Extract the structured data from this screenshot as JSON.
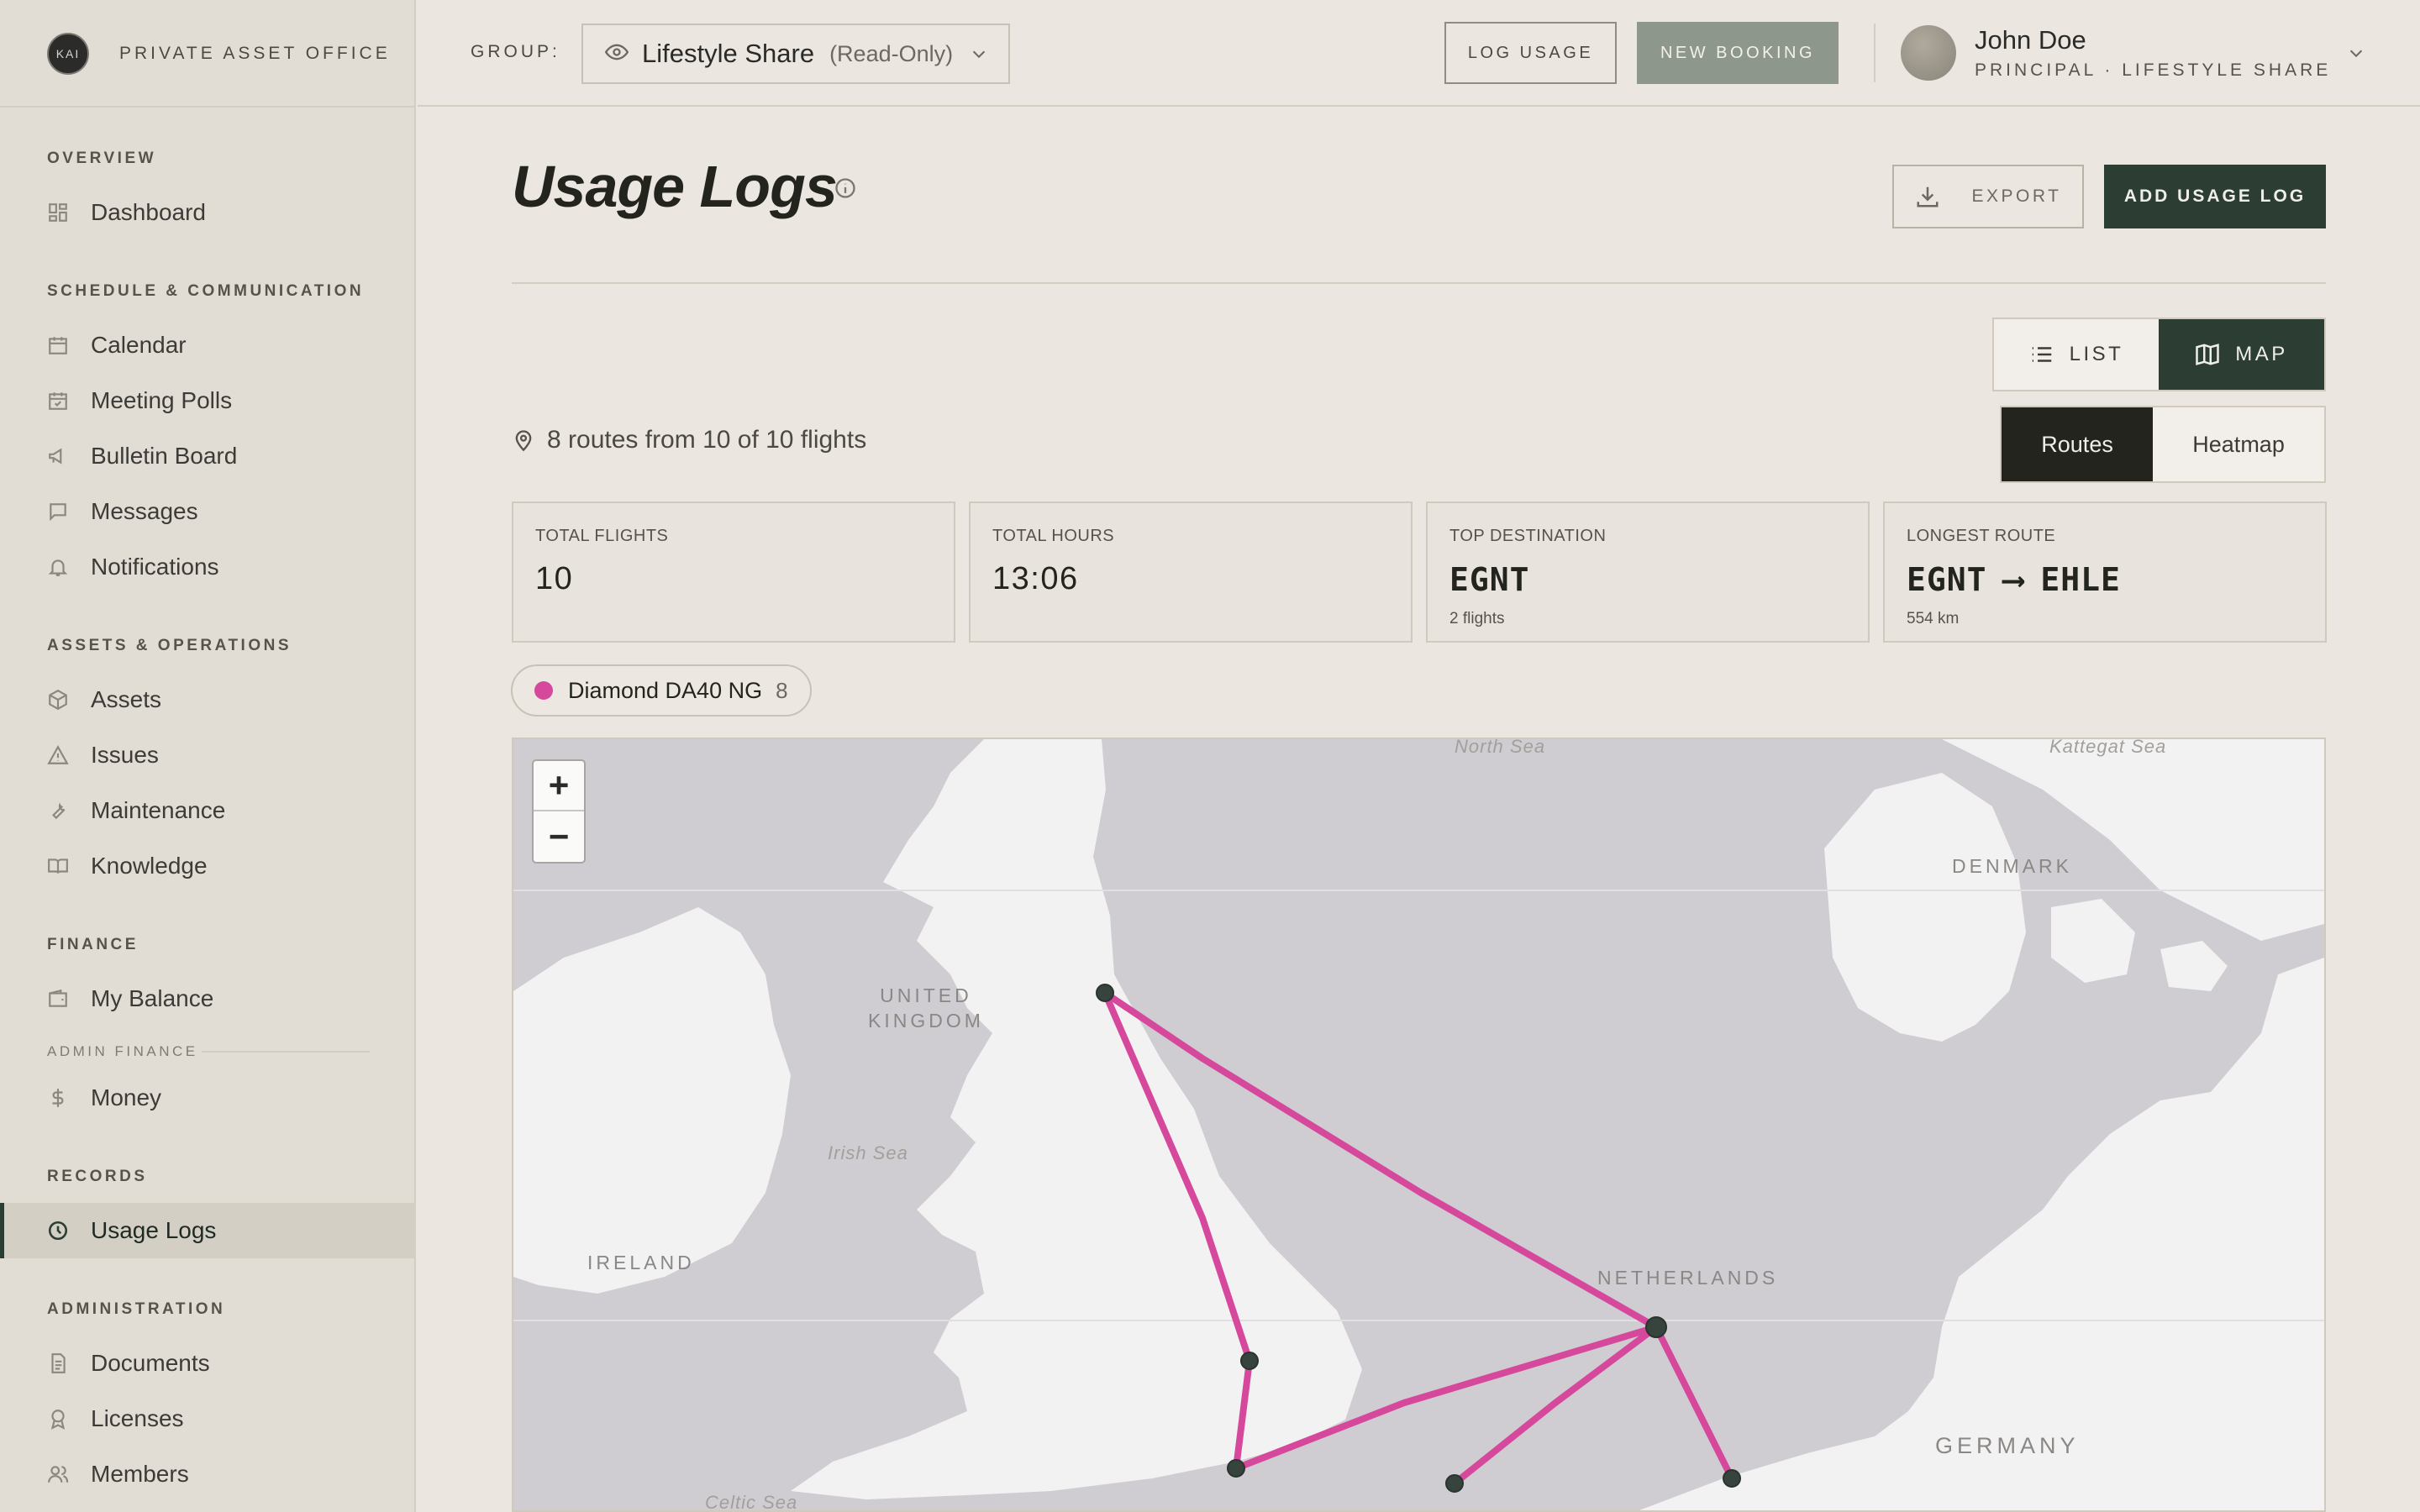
{
  "brand": {
    "logo_text": "KAI",
    "name": "PRIVATE ASSET OFFICE"
  },
  "sidebar": {
    "sections": [
      {
        "title": "OVERVIEW",
        "items": [
          {
            "label": "Dashboard",
            "icon": "dashboard-icon"
          }
        ]
      },
      {
        "title": "SCHEDULE & COMMUNICATION",
        "items": [
          {
            "label": "Calendar",
            "icon": "calendar-icon"
          },
          {
            "label": "Meeting Polls",
            "icon": "calendar-check-icon"
          },
          {
            "label": "Bulletin Board",
            "icon": "megaphone-icon"
          },
          {
            "label": "Messages",
            "icon": "message-icon"
          },
          {
            "label": "Notifications",
            "icon": "bell-icon"
          }
        ]
      },
      {
        "title": "ASSETS & OPERATIONS",
        "items": [
          {
            "label": "Assets",
            "icon": "box-icon"
          },
          {
            "label": "Issues",
            "icon": "warning-icon"
          },
          {
            "label": "Maintenance",
            "icon": "wrench-icon"
          },
          {
            "label": "Knowledge",
            "icon": "book-icon"
          }
        ]
      },
      {
        "title": "FINANCE",
        "items": [
          {
            "label": "My Balance",
            "icon": "wallet-icon"
          }
        ],
        "subsection": "ADMIN FINANCE",
        "sub_items": [
          {
            "label": "Money",
            "icon": "dollar-icon"
          }
        ]
      },
      {
        "title": "RECORDS",
        "items": [
          {
            "label": "Usage Logs",
            "icon": "clock-icon",
            "active": true
          }
        ]
      },
      {
        "title": "ADMINISTRATION",
        "items": [
          {
            "label": "Documents",
            "icon": "document-icon"
          },
          {
            "label": "Licenses",
            "icon": "award-icon"
          },
          {
            "label": "Members",
            "icon": "users-icon"
          }
        ]
      }
    ]
  },
  "header": {
    "group_label": "GROUP:",
    "group_name": "Lifestyle Share",
    "group_mode": "(Read-Only)",
    "log_usage": "LOG USAGE",
    "new_booking": "NEW BOOKING",
    "user_name": "John Doe",
    "user_role": "PRINCIPAL · LIFESTYLE SHARE"
  },
  "page": {
    "title": "Usage Logs",
    "export": "EXPORT",
    "add": "ADD USAGE LOG",
    "view_list": "LIST",
    "view_map": "MAP",
    "active_view": "MAP",
    "routes_summary": "8 routes from 10 of 10 flights",
    "mode_routes": "Routes",
    "mode_heatmap": "Heatmap",
    "active_mode": "Routes"
  },
  "stats": {
    "total_flights_label": "TOTAL FLIGHTS",
    "total_flights": "10",
    "total_hours_label": "TOTAL HOURS",
    "total_hours": "13:06",
    "top_dest_label": "TOP DESTINATION",
    "top_dest": "EGNT",
    "top_dest_sub": "2 flights",
    "longest_label": "LONGEST ROUTE",
    "longest_from": "EGNT",
    "longest_arrow": "⟶",
    "longest_to": "EHLE",
    "longest_sub": "554 km"
  },
  "aircraft_filter": {
    "name": "Diamond DA40 NG",
    "count": "8",
    "color": "#d6489c"
  },
  "map": {
    "zoom_in": "+",
    "zoom_out": "−",
    "labels": {
      "north_sea": "North Sea",
      "kattegat": "Kattegat Sea",
      "denmark": "DENMARK",
      "uk_1": "UNITED",
      "uk_2": "KINGDOM",
      "irish_sea": "Irish Sea",
      "ireland": "IRELAND",
      "netherlands": "NETHERLANDS",
      "germany": "GERMANY",
      "celtic_sea": "Celtic Sea"
    },
    "route_color": "#d6489c",
    "node_color": "#36443d",
    "land_color": "#f2f2f2",
    "water_color": "#cfcdd1"
  }
}
